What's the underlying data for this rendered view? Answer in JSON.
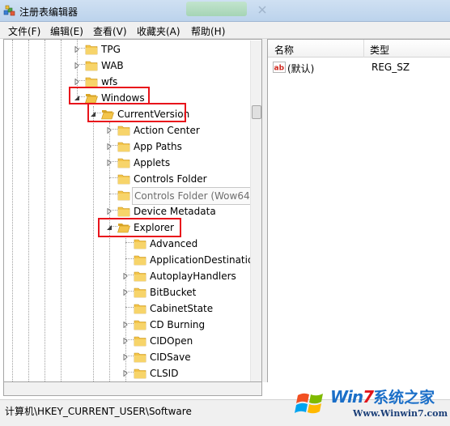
{
  "window": {
    "title": "注册表编辑器"
  },
  "menu": [
    {
      "label": "文件(F)"
    },
    {
      "label": "编辑(E)"
    },
    {
      "label": "查看(V)"
    },
    {
      "label": "收藏夹(A)"
    },
    {
      "label": "帮助(H)"
    }
  ],
  "tree": {
    "nodes": [
      {
        "label": "TPG",
        "expander": "collapsed"
      },
      {
        "label": "WAB",
        "expander": "collapsed"
      },
      {
        "label": "wfs",
        "expander": "collapsed"
      },
      {
        "label": "Windows",
        "expander": "expanded",
        "highlighted": true
      },
      {
        "label": "CurrentVersion",
        "expander": "expanded",
        "highlighted": true
      },
      {
        "label": "Action Center",
        "expander": "collapsed"
      },
      {
        "label": "App Paths",
        "expander": "collapsed"
      },
      {
        "label": "Applets",
        "expander": "collapsed"
      },
      {
        "label": "Controls Folder",
        "expander": "none"
      },
      {
        "label": "Controls Folder (Wow64)",
        "expander": "none",
        "hover": true
      },
      {
        "label": "Device Metadata",
        "expander": "collapsed"
      },
      {
        "label": "Explorer",
        "expander": "expanded",
        "highlighted": true
      },
      {
        "label": "Advanced",
        "expander": "none"
      },
      {
        "label": "ApplicationDestinatio",
        "expander": "none"
      },
      {
        "label": "AutoplayHandlers",
        "expander": "collapsed"
      },
      {
        "label": "BitBucket",
        "expander": "collapsed"
      },
      {
        "label": "CabinetState",
        "expander": "none"
      },
      {
        "label": "CD Burning",
        "expander": "collapsed"
      },
      {
        "label": "CIDOpen",
        "expander": "collapsed"
      },
      {
        "label": "CIDSave",
        "expander": "collapsed"
      },
      {
        "label": "CLSID",
        "expander": "collapsed"
      }
    ]
  },
  "values": {
    "headers": {
      "name": "名称",
      "type": "类型"
    },
    "rows": [
      {
        "name": "(默认)",
        "type": "REG_SZ"
      }
    ]
  },
  "status": {
    "path": "计算机\\HKEY_CURRENT_USER\\Software"
  },
  "watermark": {
    "brand_a": "Win",
    "brand_b": "7",
    "brand_c": "系统之家",
    "url": "Www.Winwin7.com"
  },
  "colors": {
    "highlight": "#e8141b",
    "folder": "#f3c44a",
    "brand": "#1b6fc8"
  }
}
